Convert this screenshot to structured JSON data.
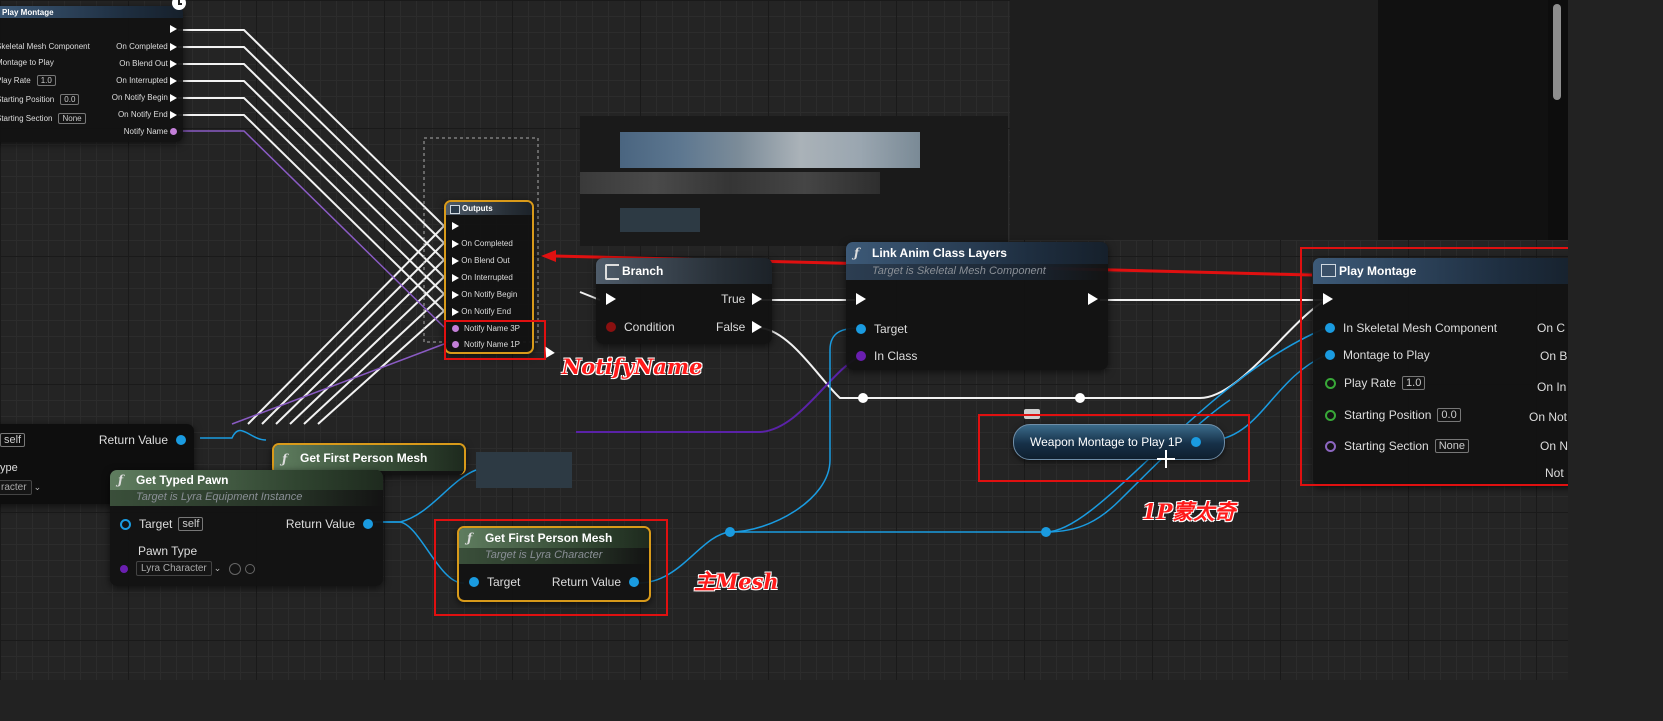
{
  "colors": {
    "exec": "#ffffff",
    "object": "#1a9be0",
    "class": "#6a1fb0",
    "float": "#38a838",
    "name": "#c37fd8",
    "bool": "#8a1010",
    "annotation": "#ff1a1a"
  },
  "top_left_node": {
    "title": "Play Montage",
    "icon": "clock-icon",
    "inputs": [
      {
        "label": "Skeletal Mesh Component"
      },
      {
        "label": "Montage to Play"
      },
      {
        "label": "Play Rate",
        "value": "1.0"
      },
      {
        "label": "Starting Position",
        "value": "0.0"
      },
      {
        "label": "Starting Section",
        "value": "None"
      }
    ],
    "outputs": [
      "On Completed",
      "On Blend Out",
      "On Interrupted",
      "On Notify Begin",
      "On Notify End",
      "Notify Name"
    ]
  },
  "outputs_node": {
    "title": "Outputs",
    "pins": [
      "On Completed",
      "On Blend Out",
      "On Interrupted",
      "On Notify Begin",
      "On Notify End",
      "Notify Name 3P",
      "Notify Name 1P"
    ]
  },
  "branch_node": {
    "title": "Branch",
    "condition": "Condition",
    "true_label": "True",
    "false_label": "False"
  },
  "link_anim_node": {
    "title": "Link Anim Class Layers",
    "subtitle": "Target is Skeletal Mesh Component",
    "target": "Target",
    "in_class": "In Class"
  },
  "play_montage_node": {
    "title": "Play Montage",
    "inputs": [
      {
        "label": "In Skeletal Mesh Component",
        "right": "On C"
      },
      {
        "label": "Montage to Play",
        "right": "On B"
      },
      {
        "label": "Play Rate",
        "value": "1.0",
        "right": "On In"
      },
      {
        "label": "Starting Position",
        "value": "0.0",
        "right": "On Not"
      },
      {
        "label": "Starting Section",
        "value": "None",
        "right": "On N"
      }
    ],
    "last_right": "Not"
  },
  "weapon_montage_var": {
    "label": "Weapon Montage to Play 1P"
  },
  "get_typed_pawn": {
    "title": "Get Typed Pawn",
    "subtitle": "Target is Lyra Equipment Instance",
    "target": "Target",
    "target_value": "self",
    "pawn_type": "Pawn Type",
    "pawn_value": "Lyra Character",
    "return": "Return Value"
  },
  "get_first_person_mesh_main": {
    "title": "Get First Person Mesh",
    "subtitle": "Target is Lyra Character",
    "target": "Target",
    "return": "Return Value"
  },
  "get_first_person_mesh_back": {
    "title": "Get First Person Mesh"
  },
  "left_partial": {
    "self_value": "self",
    "return": "Return Value",
    "type_fragment": "ype",
    "dropdown": "racter"
  },
  "annotations": {
    "notify_name": "NotifyName",
    "main_mesh": "主Mesh",
    "montage_1p": "1P蒙太奇"
  }
}
